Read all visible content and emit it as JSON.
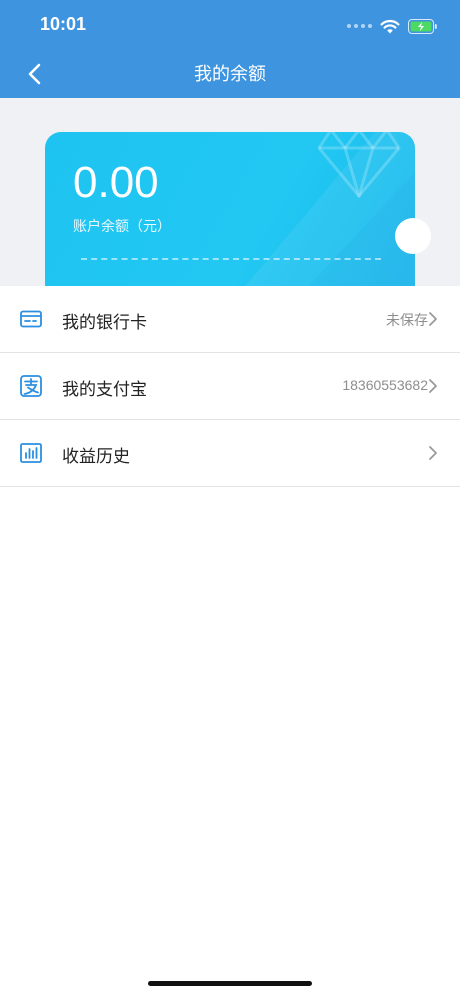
{
  "status_bar": {
    "time": "10:01"
  },
  "header": {
    "title": "我的余额"
  },
  "balance_card": {
    "amount": "0.00",
    "label": "账户余额（元）",
    "currency_symbol": "¥"
  },
  "list": [
    {
      "label": "我的银行卡",
      "value": "未保存",
      "icon": "bank-card-icon"
    },
    {
      "label": "我的支付宝",
      "value": "18360553682",
      "icon": "alipay-icon"
    },
    {
      "label": "收益历史",
      "value": "",
      "icon": "bar-chart-icon"
    }
  ],
  "colors": {
    "header_bg": "#3f94df",
    "card_bg": "#1ec3f1",
    "icon_blue": "#2b8fe0"
  }
}
